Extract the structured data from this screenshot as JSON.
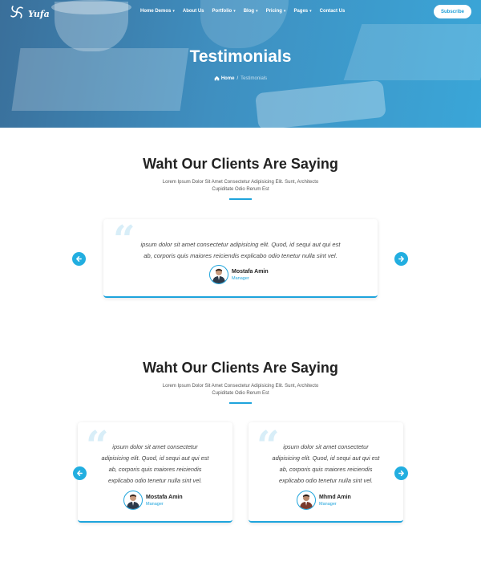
{
  "brand": {
    "name": "Yufa"
  },
  "nav": {
    "items": [
      {
        "label": "Home Demos",
        "has_dropdown": true
      },
      {
        "label": "About Us",
        "has_dropdown": false
      },
      {
        "label": "Portfolio",
        "has_dropdown": true
      },
      {
        "label": "Blog",
        "has_dropdown": true
      },
      {
        "label": "Pricing",
        "has_dropdown": true
      },
      {
        "label": "Pages",
        "has_dropdown": true
      },
      {
        "label": "Contact Us",
        "has_dropdown": false
      }
    ],
    "subscribe_label": "Subscribe"
  },
  "hero": {
    "title": "Testimonials",
    "breadcrumb": {
      "home": "Home",
      "separator": "/",
      "current": "Testimonials"
    }
  },
  "section1": {
    "title": "Waht Our Clients Are Saying",
    "subtitle_line1": "Lorem Ipsum Dolor Sit Amet Consectetur Adipisicing Elit. Sunt, Architecto",
    "subtitle_line2": "Cupiditate Odio Rerum Est",
    "testimonial": {
      "text_line1": "ipsum dolor sit amet consectetur adipisicing elit. Quod, id sequi aut qui est",
      "text_line2": "ab, corporis quis maiores reiciendis explicabo odio tenetur nulla sint vel.",
      "name": "Mostafa Amin",
      "role": "Manager"
    }
  },
  "section2": {
    "title": "Waht Our Clients Are Saying",
    "subtitle_line1": "Lorem Ipsum Dolor Sit Amet Consectetur Adipisicing Elit. Sunt, Architecto",
    "subtitle_line2": "Cupiditate Odio Rerum Est",
    "testimonials": [
      {
        "lines": [
          "ipsum dolor sit amet consectetur",
          "adipisicing elit. Quod, id sequi aut qui est",
          "ab, corporis quis maiores reiciendis",
          "explicabo odio tenetur nulla sint vel."
        ],
        "name": "Mostafa Amin",
        "role": "Manager"
      },
      {
        "lines": [
          "ipsum dolor sit amet consectetur",
          "adipisicing elit. Quod, id sequi aut qui est",
          "ab, corporis quis maiores reiciendis",
          "explicabo odio tenetur nulla sint vel."
        ],
        "name": "Mhmd Amin",
        "role": "Manager"
      }
    ]
  },
  "icons": {
    "logo": "swirl-logo-icon",
    "home": "home-icon",
    "prev": "arrow-left-icon",
    "next": "arrow-right-icon",
    "quote": "quote-icon"
  },
  "colors": {
    "accent": "#1ea4dc",
    "hero_start": "#3a6f9a",
    "hero_end": "#3aa6d8"
  }
}
